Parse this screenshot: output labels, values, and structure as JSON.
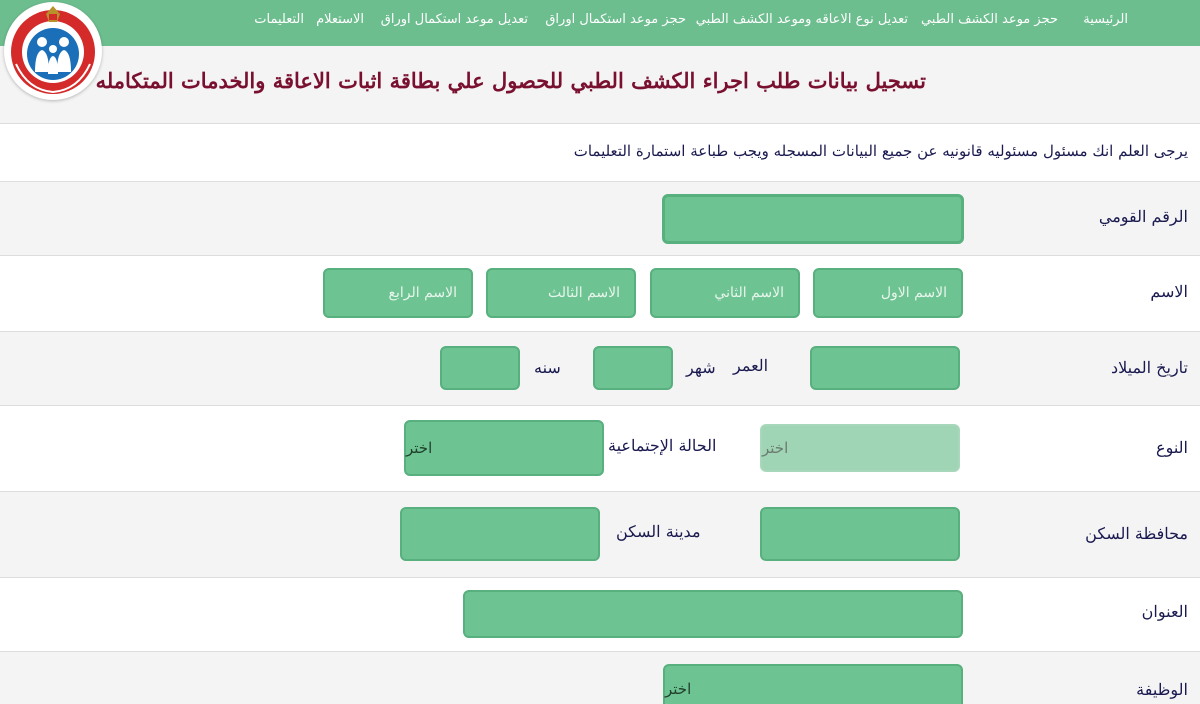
{
  "nav": {
    "items": [
      "الرئيسية",
      "حجز موعد الكشف الطبي",
      "تعديل نوع الاعاقه وموعد الكشف الطبي",
      "حجز موعد استكمال اوراق",
      "تعديل موعد استكمال اوراق",
      "الاستعلام",
      "التعليمات"
    ]
  },
  "colors": {
    "nav_background": "#6dbe8f",
    "field_fill": "#6dc392",
    "title_color": "#7a1030",
    "text_color": "#1a1a50"
  },
  "logo": {
    "icon": "ministry-of-health-logo"
  },
  "header": {
    "title": "تسجيل بيانات طلب اجراء الكشف الطبي للحصول علي بطاقة اثبات الاعاقة والخدمات المتكامله"
  },
  "notice": {
    "text": "يرجى العلم انك مسئول مسئوليه قانونيه عن جميع البيانات المسجله ويجب طباعة استمارة التعليمات"
  },
  "form": {
    "national_id": {
      "label": "الرقم القومي",
      "value": ""
    },
    "name": {
      "label": "الاسم",
      "first_placeholder": "الاسم الاول",
      "second_placeholder": "الاسم الثاني",
      "third_placeholder": "الاسم الثالث",
      "fourth_placeholder": "الاسم الرابع"
    },
    "birth_date": {
      "label": "تاريخ الميلاد",
      "age_label": "العمر",
      "month_label": "شهر",
      "year_label": "سنه"
    },
    "gender": {
      "label": "النوع",
      "selected": "اختر"
    },
    "marital_status": {
      "label": "الحالة الإجتماعية",
      "selected": "اختر"
    },
    "governorate": {
      "label": "محافظة السكن",
      "value": ""
    },
    "city": {
      "label": "مدينة السكن",
      "value": ""
    },
    "address": {
      "label": "العنوان",
      "value": ""
    },
    "job": {
      "label": "الوظيفة",
      "selected": "اختر"
    }
  }
}
